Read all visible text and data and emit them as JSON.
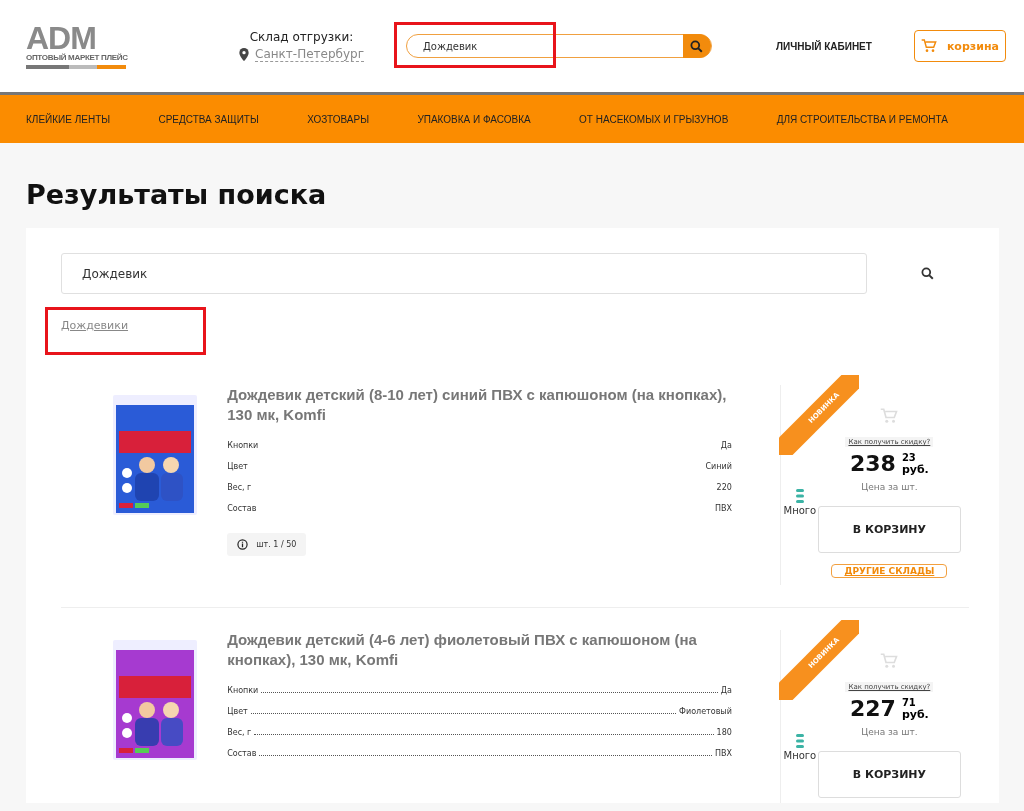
{
  "header": {
    "logo": {
      "mark": "ADM",
      "tagline": "ОПТОВЫЙ МАРКЕТ ПЛЕЙС"
    },
    "warehouse": {
      "label": "Склад отгрузки:",
      "city": "Санкт-Петербург"
    },
    "search": {
      "value": "Дождевик",
      "highlighted": true
    },
    "account": "ЛИЧНЫЙ КАБИНЕТ",
    "cart": "корзина"
  },
  "nav": [
    "КЛЕЙКИЕ ЛЕНТЫ",
    "СРЕДСТВА ЗАЩИТЫ",
    "ХОЗТОВАРЫ",
    "УПАКОВКА И ФАСОВКА",
    "ОТ НАСЕКОМЫХ И ГРЫЗУНОВ",
    "ДЛЯ СТРОИТЕЛЬСТВА И РЕМОНТА"
  ],
  "page_title": "Результаты поиска",
  "results": {
    "search": {
      "value": "Дождевик"
    },
    "suggestions": [
      {
        "label": "Дождевики",
        "highlighted": true
      }
    ],
    "products": [
      {
        "title": "Дождевик детский (8-10 лет) синий ПВХ с капюшоном (на кнопках), 130 мк, Komfi",
        "leaders": false,
        "specs": [
          {
            "name": "Кнопки",
            "value": "Да"
          },
          {
            "name": "Цвет",
            "value": "Синий"
          },
          {
            "name": "Вес, г",
            "value": "220"
          },
          {
            "name": "Состав",
            "value": "ПВХ"
          }
        ],
        "pack": "шт. 1 / 50",
        "badge": "НОВИНКА",
        "stock": "Много",
        "discount_link": "Как получить скидку?",
        "price": {
          "rub": "238",
          "kop": "23",
          "unit": "руб."
        },
        "price_note": "Цена за шт.",
        "add_button": "В КОРЗИНУ",
        "other_warehouses": "ДРУГИЕ СКЛАДЫ"
      },
      {
        "title": "Дождевик детский (4-6 лет) фиолетовый ПВХ с капюшоном (на кнопках), 130 мк, Komfi",
        "leaders": true,
        "specs": [
          {
            "name": "Кнопки",
            "value": "Да"
          },
          {
            "name": "Цвет",
            "value": "Фиолетовый"
          },
          {
            "name": "Вес, г",
            "value": "180"
          },
          {
            "name": "Состав",
            "value": "ПВХ"
          }
        ],
        "badge": "НОВИНКА",
        "stock": "Много",
        "discount_link": "Как получить скидку?",
        "price": {
          "rub": "227",
          "kop": "71",
          "unit": "руб."
        },
        "price_note": "Цена за шт.",
        "add_button": "В КОРЗИНУ"
      }
    ]
  }
}
